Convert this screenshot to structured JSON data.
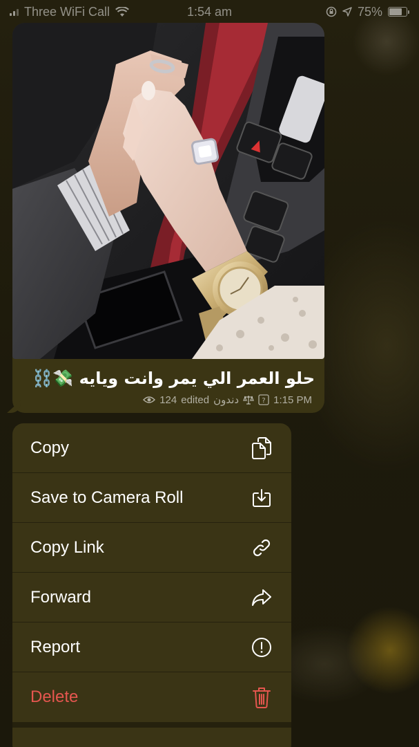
{
  "status_bar": {
    "carrier": "Three WiFi Call",
    "time": "1:54 am",
    "battery": "75%",
    "battery_level": 0.75
  },
  "message": {
    "caption": "حلو العمر الي يمر وانت ويايه 💸⛓️",
    "views": "124",
    "edited": "edited",
    "author": "دندون",
    "time": "1:15 PM",
    "icons": [
      "eye-icon",
      "scales-icon",
      "number-box-icon"
    ]
  },
  "menu": {
    "items": [
      {
        "label": "Copy",
        "icon": "copy-icon"
      },
      {
        "label": "Save to Camera Roll",
        "icon": "save-download-icon"
      },
      {
        "label": "Copy Link",
        "icon": "link-icon"
      },
      {
        "label": "Forward",
        "icon": "forward-arrow-icon"
      },
      {
        "label": "Report",
        "icon": "report-exclamation-icon"
      },
      {
        "label": "Delete",
        "icon": "trash-icon"
      }
    ],
    "delete_color": "#e5564f"
  },
  "colors": {
    "bubble": "#3b3514",
    "menu": "#3a3415",
    "background": "#1d1a0c"
  }
}
